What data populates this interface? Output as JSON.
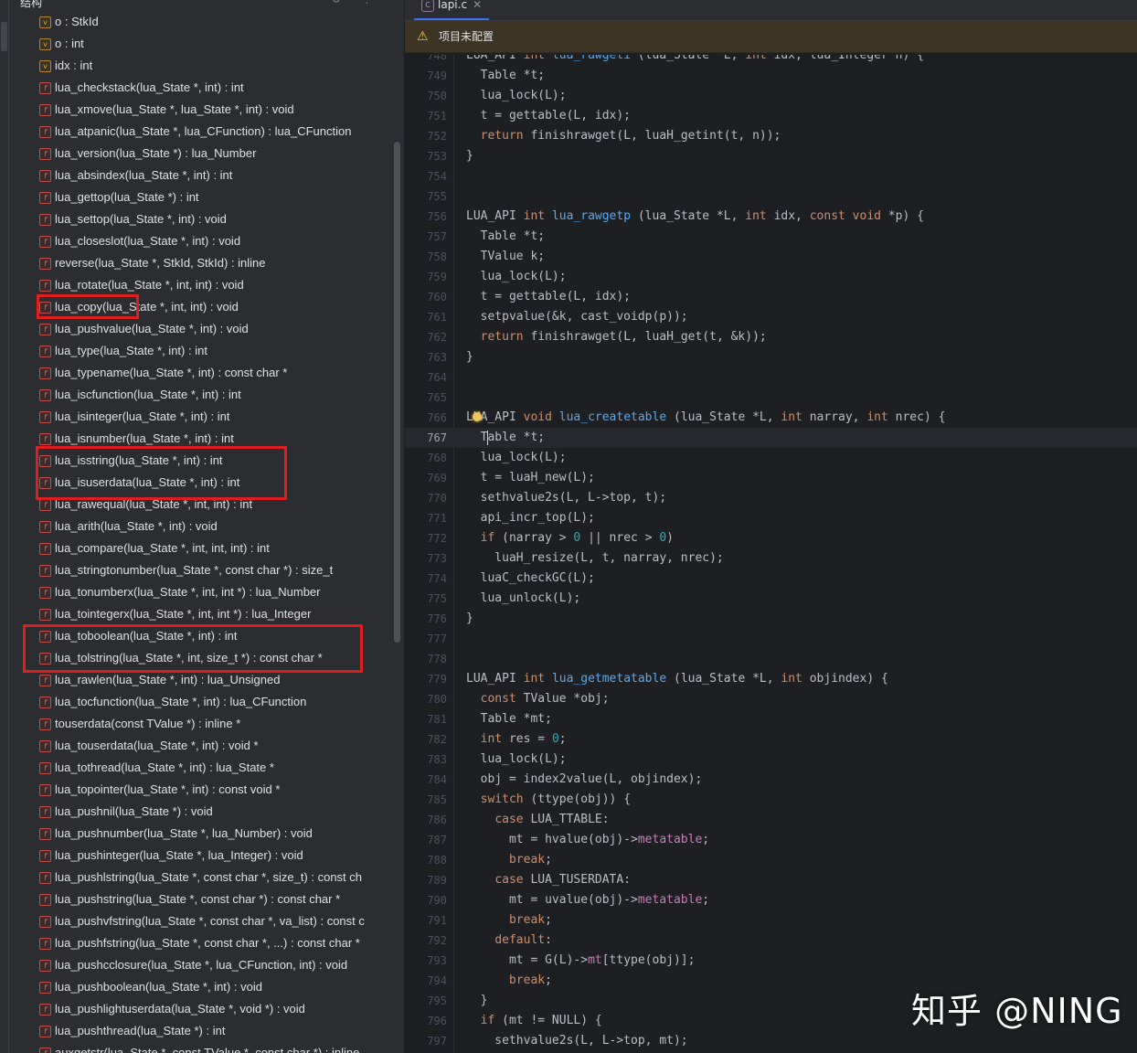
{
  "structure_panel": {
    "title": "结构",
    "items": [
      {
        "icon": "var",
        "text": "o : StkId"
      },
      {
        "icon": "var",
        "text": "o : int"
      },
      {
        "icon": "var",
        "text": "idx : int"
      },
      {
        "icon": "fn",
        "text": "lua_checkstack(lua_State *, int) : int"
      },
      {
        "icon": "fn",
        "text": "lua_xmove(lua_State *, lua_State *, int) : void"
      },
      {
        "icon": "fn",
        "text": "lua_atpanic(lua_State *, lua_CFunction) : lua_CFunction"
      },
      {
        "icon": "fn",
        "text": "lua_version(lua_State *) : lua_Number"
      },
      {
        "icon": "fn",
        "text": "lua_absindex(lua_State *, int) : int"
      },
      {
        "icon": "fn",
        "text": "lua_gettop(lua_State *) : int"
      },
      {
        "icon": "fn",
        "text": "lua_settop(lua_State *, int) : void"
      },
      {
        "icon": "fn",
        "text": "lua_closeslot(lua_State *, int) : void"
      },
      {
        "icon": "fn",
        "text": "reverse(lua_State *, StkId, StkId) : inline"
      },
      {
        "icon": "fn",
        "text": "lua_rotate(lua_State *, int, int) : void"
      },
      {
        "icon": "fn",
        "text": "lua_copy(lua_State *, int, int) : void"
      },
      {
        "icon": "fn",
        "text": "lua_pushvalue(lua_State *, int) : void"
      },
      {
        "icon": "fn",
        "text": "lua_type(lua_State *, int) : int"
      },
      {
        "icon": "fn",
        "text": "lua_typename(lua_State *, int) : const char *"
      },
      {
        "icon": "fn",
        "text": "lua_iscfunction(lua_State *, int) : int"
      },
      {
        "icon": "fn",
        "text": "lua_isinteger(lua_State *, int) : int"
      },
      {
        "icon": "fn",
        "text": "lua_isnumber(lua_State *, int) : int"
      },
      {
        "icon": "fn",
        "text": "lua_isstring(lua_State *, int) : int"
      },
      {
        "icon": "fn",
        "text": "lua_isuserdata(lua_State *, int) : int"
      },
      {
        "icon": "fn",
        "text": "lua_rawequal(lua_State *, int, int) : int"
      },
      {
        "icon": "fn",
        "text": "lua_arith(lua_State *, int) : void"
      },
      {
        "icon": "fn",
        "text": "lua_compare(lua_State *, int, int, int) : int"
      },
      {
        "icon": "fn",
        "text": "lua_stringtonumber(lua_State *, const char *) : size_t"
      },
      {
        "icon": "fn",
        "text": "lua_tonumberx(lua_State *, int, int *) : lua_Number"
      },
      {
        "icon": "fn",
        "text": "lua_tointegerx(lua_State *, int, int *) : lua_Integer"
      },
      {
        "icon": "fn",
        "text": "lua_toboolean(lua_State *, int) : int"
      },
      {
        "icon": "fn",
        "text": "lua_tolstring(lua_State *, int, size_t *) : const char *"
      },
      {
        "icon": "fn",
        "text": "lua_rawlen(lua_State *, int) : lua_Unsigned"
      },
      {
        "icon": "fn",
        "text": "lua_tocfunction(lua_State *, int) : lua_CFunction"
      },
      {
        "icon": "fn",
        "text": "touserdata(const TValue *) : inline *"
      },
      {
        "icon": "fn",
        "text": "lua_touserdata(lua_State *, int) : void *"
      },
      {
        "icon": "fn",
        "text": "lua_tothread(lua_State *, int) : lua_State *"
      },
      {
        "icon": "fn",
        "text": "lua_topointer(lua_State *, int) : const void *"
      },
      {
        "icon": "fn",
        "text": "lua_pushnil(lua_State *) : void"
      },
      {
        "icon": "fn",
        "text": "lua_pushnumber(lua_State *, lua_Number) : void"
      },
      {
        "icon": "fn",
        "text": "lua_pushinteger(lua_State *, lua_Integer) : void"
      },
      {
        "icon": "fn",
        "text": "lua_pushlstring(lua_State *, const char *, size_t) : const ch"
      },
      {
        "icon": "fn",
        "text": "lua_pushstring(lua_State *, const char *) : const char *"
      },
      {
        "icon": "fn",
        "text": "lua_pushvfstring(lua_State *, const char *, va_list) : const c"
      },
      {
        "icon": "fn",
        "text": "lua_pushfstring(lua_State *, const char *, ...) : const char *"
      },
      {
        "icon": "fn",
        "text": "lua_pushcclosure(lua_State *, lua_CFunction, int) : void"
      },
      {
        "icon": "fn",
        "text": "lua_pushboolean(lua_State *, int) : void"
      },
      {
        "icon": "fn",
        "text": "lua_pushlightuserdata(lua_State *, void *) : void"
      },
      {
        "icon": "fn",
        "text": "lua_pushthread(lua_State *) : int"
      },
      {
        "icon": "fn",
        "text": "auxgetstr(lua_State *, const TValue *, const char *) : inline"
      }
    ]
  },
  "editor": {
    "tab_label": "lapi.c",
    "warning_text": "项目未配置",
    "current_line": 767,
    "lines": [
      {
        "n": "748",
        "segs": [
          [
            "t",
            "LUA_API "
          ],
          [
            "kw",
            "int "
          ],
          [
            "fn",
            "lua_rawgeti"
          ],
          [
            "t",
            " (lua_State *L, "
          ],
          [
            "kw",
            "int "
          ],
          [
            "t",
            "idx, lua_Integer n) {"
          ]
        ]
      },
      {
        "n": "749",
        "segs": [
          [
            "t",
            "  Table *t;"
          ]
        ]
      },
      {
        "n": "750",
        "segs": [
          [
            "t",
            "  lua_lock(L);"
          ]
        ]
      },
      {
        "n": "751",
        "segs": [
          [
            "t",
            "  t = gettable(L, idx);"
          ]
        ]
      },
      {
        "n": "752",
        "segs": [
          [
            "t",
            "  "
          ],
          [
            "kw",
            "return "
          ],
          [
            "t",
            "finishrawget(L, luaH_getint(t, n));"
          ]
        ]
      },
      {
        "n": "753",
        "segs": [
          [
            "t",
            "}"
          ]
        ]
      },
      {
        "n": "754",
        "segs": []
      },
      {
        "n": "755",
        "segs": []
      },
      {
        "n": "756",
        "segs": [
          [
            "t",
            "LUA_API "
          ],
          [
            "kw",
            "int "
          ],
          [
            "fn",
            "lua_rawgetp"
          ],
          [
            "t",
            " (lua_State *L, "
          ],
          [
            "kw",
            "int "
          ],
          [
            "t",
            "idx, "
          ],
          [
            "kw",
            "const void "
          ],
          [
            "t",
            "*p) {"
          ]
        ]
      },
      {
        "n": "757",
        "segs": [
          [
            "t",
            "  Table *t;"
          ]
        ]
      },
      {
        "n": "758",
        "segs": [
          [
            "t",
            "  TValue k;"
          ]
        ]
      },
      {
        "n": "759",
        "segs": [
          [
            "t",
            "  lua_lock(L);"
          ]
        ]
      },
      {
        "n": "760",
        "segs": [
          [
            "t",
            "  t = gettable(L, idx);"
          ]
        ]
      },
      {
        "n": "761",
        "segs": [
          [
            "t",
            "  setpvalue(&k, cast_voidp(p));"
          ]
        ]
      },
      {
        "n": "762",
        "segs": [
          [
            "t",
            "  "
          ],
          [
            "kw",
            "return "
          ],
          [
            "t",
            "finishrawget(L, luaH_get(t, &k));"
          ]
        ]
      },
      {
        "n": "763",
        "segs": [
          [
            "t",
            "}"
          ]
        ]
      },
      {
        "n": "764",
        "segs": []
      },
      {
        "n": "765",
        "segs": []
      },
      {
        "n": "766",
        "segs": [
          [
            "t",
            "LUA_API "
          ],
          [
            "kw",
            "void "
          ],
          [
            "fn",
            "lua_createtable"
          ],
          [
            "t",
            " (lua_State *L, "
          ],
          [
            "kw",
            "int "
          ],
          [
            "t",
            "narray, "
          ],
          [
            "kw",
            "int "
          ],
          [
            "t",
            "nrec) {"
          ]
        ]
      },
      {
        "n": "767",
        "segs": [
          [
            "t",
            "  Table *t;"
          ]
        ]
      },
      {
        "n": "768",
        "segs": [
          [
            "t",
            "  lua_lock(L);"
          ]
        ]
      },
      {
        "n": "769",
        "segs": [
          [
            "t",
            "  t = luaH_new(L);"
          ]
        ]
      },
      {
        "n": "770",
        "segs": [
          [
            "t",
            "  sethvalue2s(L, L->top, t);"
          ]
        ]
      },
      {
        "n": "771",
        "segs": [
          [
            "t",
            "  api_incr_top(L);"
          ]
        ]
      },
      {
        "n": "772",
        "segs": [
          [
            "t",
            "  "
          ],
          [
            "kw",
            "if "
          ],
          [
            "t",
            "(narray > "
          ],
          [
            "num",
            "0"
          ],
          [
            "t",
            " || nrec > "
          ],
          [
            "num",
            "0"
          ],
          [
            "t",
            ")"
          ]
        ]
      },
      {
        "n": "773",
        "segs": [
          [
            "t",
            "    luaH_resize(L, t, narray, nrec);"
          ]
        ]
      },
      {
        "n": "774",
        "segs": [
          [
            "t",
            "  luaC_checkGC(L);"
          ]
        ]
      },
      {
        "n": "775",
        "segs": [
          [
            "t",
            "  lua_unlock(L);"
          ]
        ]
      },
      {
        "n": "776",
        "segs": [
          [
            "t",
            "}"
          ]
        ]
      },
      {
        "n": "777",
        "segs": []
      },
      {
        "n": "778",
        "segs": []
      },
      {
        "n": "779",
        "segs": [
          [
            "t",
            "LUA_API "
          ],
          [
            "kw",
            "int "
          ],
          [
            "fn",
            "lua_getmetatable"
          ],
          [
            "t",
            " (lua_State *L, "
          ],
          [
            "kw",
            "int "
          ],
          [
            "t",
            "objindex) {"
          ]
        ]
      },
      {
        "n": "780",
        "segs": [
          [
            "t",
            "  "
          ],
          [
            "kw",
            "const "
          ],
          [
            "t",
            "TValue *obj;"
          ]
        ]
      },
      {
        "n": "781",
        "segs": [
          [
            "t",
            "  Table *mt;"
          ]
        ]
      },
      {
        "n": "782",
        "segs": [
          [
            "t",
            "  "
          ],
          [
            "kw",
            "int "
          ],
          [
            "t",
            "res = "
          ],
          [
            "num",
            "0"
          ],
          [
            "t",
            ";"
          ]
        ]
      },
      {
        "n": "783",
        "segs": [
          [
            "t",
            "  lua_lock(L);"
          ]
        ]
      },
      {
        "n": "784",
        "segs": [
          [
            "t",
            "  obj = index2value(L, objindex);"
          ]
        ]
      },
      {
        "n": "785",
        "segs": [
          [
            "t",
            "  "
          ],
          [
            "kw",
            "switch "
          ],
          [
            "t",
            "(ttype(obj)) {"
          ]
        ]
      },
      {
        "n": "786",
        "segs": [
          [
            "t",
            "    "
          ],
          [
            "kw",
            "case "
          ],
          [
            "t",
            "LUA_TTABLE:"
          ]
        ]
      },
      {
        "n": "787",
        "segs": [
          [
            "t",
            "      mt = hvalue(obj)->"
          ],
          [
            "fld",
            "metatable"
          ],
          [
            "t",
            ";"
          ]
        ]
      },
      {
        "n": "788",
        "segs": [
          [
            "t",
            "      "
          ],
          [
            "kw",
            "break"
          ],
          [
            "t",
            ";"
          ]
        ]
      },
      {
        "n": "789",
        "segs": [
          [
            "t",
            "    "
          ],
          [
            "kw",
            "case "
          ],
          [
            "t",
            "LUA_TUSERDATA:"
          ]
        ]
      },
      {
        "n": "790",
        "segs": [
          [
            "t",
            "      mt = uvalue(obj)->"
          ],
          [
            "fld",
            "metatable"
          ],
          [
            "t",
            ";"
          ]
        ]
      },
      {
        "n": "791",
        "segs": [
          [
            "t",
            "      "
          ],
          [
            "kw",
            "break"
          ],
          [
            "t",
            ";"
          ]
        ]
      },
      {
        "n": "792",
        "segs": [
          [
            "t",
            "    "
          ],
          [
            "kw",
            "default"
          ],
          [
            "t",
            ":"
          ]
        ]
      },
      {
        "n": "793",
        "segs": [
          [
            "t",
            "      mt = G(L)->"
          ],
          [
            "fld",
            "mt"
          ],
          [
            "t",
            "[ttype(obj)];"
          ]
        ]
      },
      {
        "n": "794",
        "segs": [
          [
            "t",
            "      "
          ],
          [
            "kw",
            "break"
          ],
          [
            "t",
            ";"
          ]
        ]
      },
      {
        "n": "795",
        "segs": [
          [
            "t",
            "  }"
          ]
        ]
      },
      {
        "n": "796",
        "segs": [
          [
            "t",
            "  "
          ],
          [
            "kw",
            "if "
          ],
          [
            "t",
            "(mt != NULL) {"
          ]
        ]
      },
      {
        "n": "797",
        "segs": [
          [
            "t",
            "    sethvalue2s(L, L->top, mt);"
          ]
        ]
      }
    ]
  },
  "watermark": "知乎 @NING",
  "colors": {
    "highlight_box": "#e01e1e",
    "keyword": "#cf8e6d",
    "function_decl": "#56a8f5",
    "number": "#2aacb8",
    "field": "#c77dbb",
    "warning_bg": "#3d3424"
  },
  "icons": {
    "function": "function-f-icon",
    "variable": "variable-v-icon",
    "warning": "warning-triangle-icon",
    "file": "c-file-icon",
    "bulb": "lightbulb-icon"
  }
}
